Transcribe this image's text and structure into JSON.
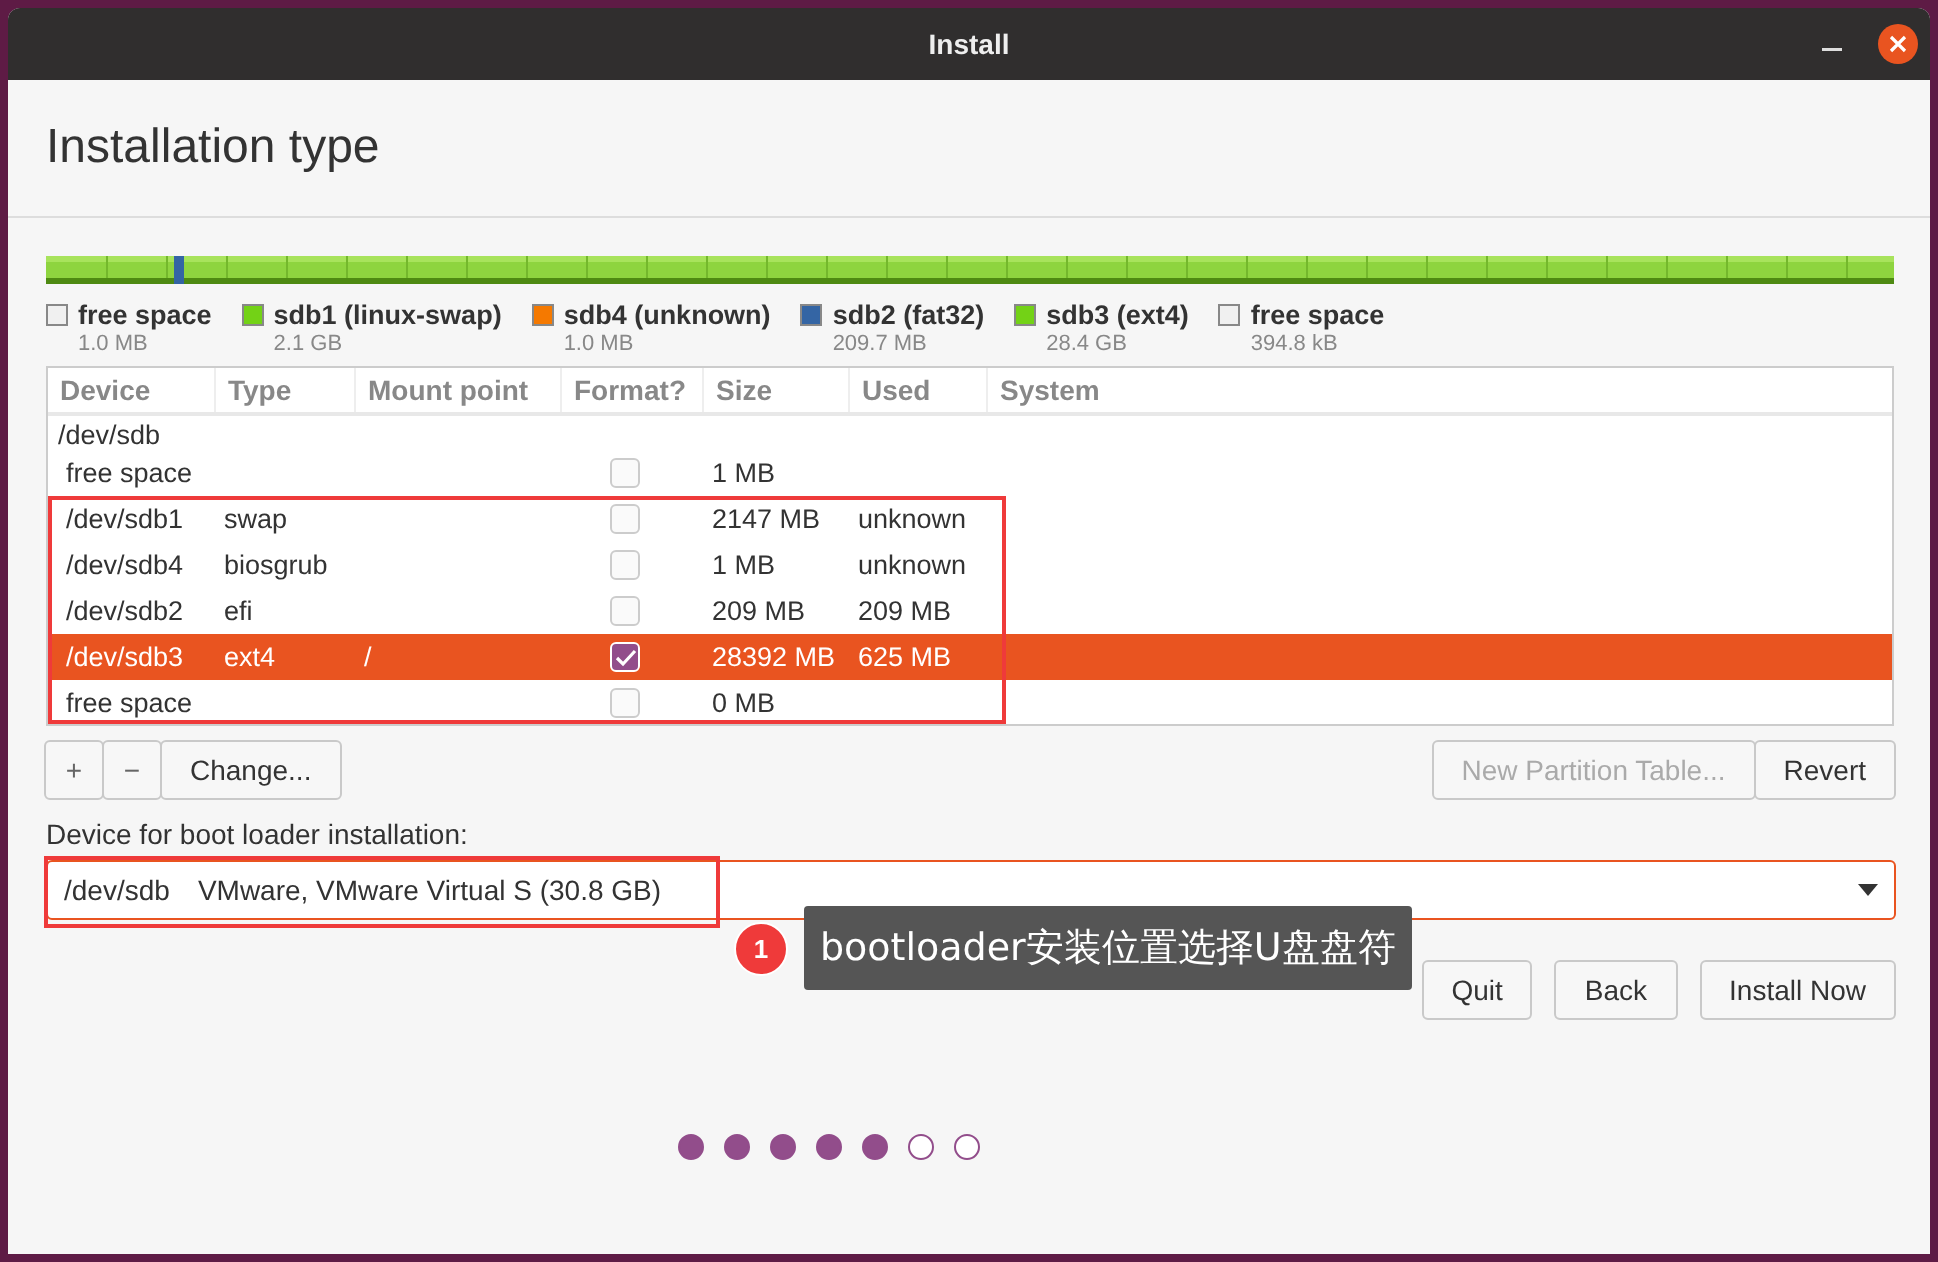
{
  "window": {
    "title": "Install"
  },
  "heading": "Installation type",
  "legend": [
    {
      "label": "free space",
      "size": "1.0 MB",
      "color": "#f0f0f0"
    },
    {
      "label": "sdb1 (linux-swap)",
      "size": "2.1 GB",
      "color": "#73d216"
    },
    {
      "label": "sdb4 (unknown)",
      "size": "1.0 MB",
      "color": "#f57900"
    },
    {
      "label": "sdb2 (fat32)",
      "size": "209.7 MB",
      "color": "#3465a4"
    },
    {
      "label": "sdb3 (ext4)",
      "size": "28.4 GB",
      "color": "#73d216"
    },
    {
      "label": "free space",
      "size": "394.8 kB",
      "color": "#f0f0f0"
    }
  ],
  "table": {
    "columns": [
      "Device",
      "Type",
      "Mount point",
      "Format?",
      "Size",
      "Used",
      "System"
    ],
    "rows": [
      {
        "device": "/dev/sdb",
        "children": [
          {
            "device": "free space",
            "format": false,
            "size": "1 MB",
            "selected": false
          },
          {
            "device": "/dev/sdb1",
            "type": "swap",
            "format": false,
            "size": "2147 MB",
            "used": "unknown",
            "selected": false
          },
          {
            "device": "/dev/sdb4",
            "type": "biosgrub",
            "format": false,
            "size": "1 MB",
            "used": "unknown",
            "selected": false
          },
          {
            "device": "/dev/sdb2",
            "type": "efi",
            "format": false,
            "size": "209 MB",
            "used": "209 MB",
            "selected": false
          },
          {
            "device": "/dev/sdb3",
            "type": "ext4",
            "mount": "/",
            "format": true,
            "size": "28392 MB",
            "used": "625 MB",
            "selected": true
          },
          {
            "device": "free space",
            "format": false,
            "size": "0 MB",
            "selected": false
          }
        ]
      }
    ]
  },
  "partition_buttons": {
    "add": "+",
    "remove": "−",
    "change": "Change...",
    "new_table": "New Partition Table...",
    "revert": "Revert"
  },
  "boot_loader": {
    "label": "Device for boot loader installation:",
    "device": "/dev/sdb",
    "description": "VMware, VMware Virtual S (30.8 GB)"
  },
  "annotation": {
    "number": "1",
    "text": "bootloader安装位置选择U盘盘符"
  },
  "buttons": [
    "Quit",
    "Back",
    "Install Now"
  ],
  "steps": [
    {
      "completed": true
    },
    {
      "completed": true
    },
    {
      "completed": true
    },
    {
      "completed": true
    },
    {
      "completed": true
    },
    {
      "completed": false
    },
    {
      "completed": false
    }
  ]
}
